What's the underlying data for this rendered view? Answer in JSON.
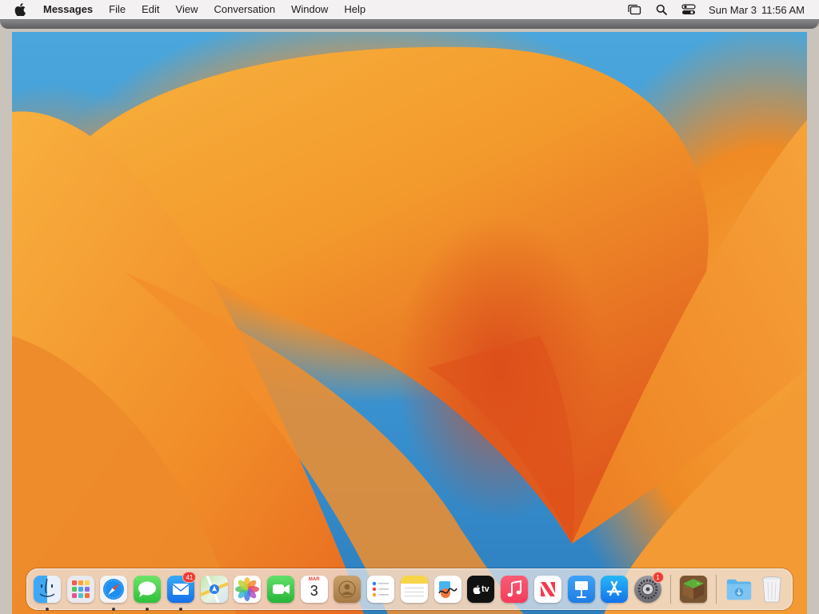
{
  "menubar": {
    "app_name": "Messages",
    "menus": [
      "File",
      "Edit",
      "View",
      "Conversation",
      "Window",
      "Help"
    ],
    "status_icons": [
      "stage-manager-icon",
      "spotlight-search-icon",
      "control-center-icon"
    ],
    "date": "Sun Mar 3",
    "time": "11:56 AM"
  },
  "dock": {
    "apps": [
      {
        "name": "Finder",
        "icon": "finder-icon",
        "running": true
      },
      {
        "name": "Launchpad",
        "icon": "launchpad-icon",
        "running": false
      },
      {
        "name": "Safari",
        "icon": "safari-icon",
        "running": true
      },
      {
        "name": "Messages",
        "icon": "messages-icon",
        "running": true
      },
      {
        "name": "Mail",
        "icon": "mail-icon",
        "running": true,
        "badge": "41"
      },
      {
        "name": "Maps",
        "icon": "maps-icon",
        "running": false
      },
      {
        "name": "Photos",
        "icon": "photos-icon",
        "running": false
      },
      {
        "name": "FaceTime",
        "icon": "facetime-icon",
        "running": false
      },
      {
        "name": "Calendar",
        "icon": "calendar-icon",
        "running": false,
        "month": "MAR",
        "day": "3"
      },
      {
        "name": "Contacts",
        "icon": "contacts-icon",
        "running": false
      },
      {
        "name": "Reminders",
        "icon": "reminders-icon",
        "running": false
      },
      {
        "name": "Notes",
        "icon": "notes-icon",
        "running": false
      },
      {
        "name": "Freeform",
        "icon": "freeform-icon",
        "running": false
      },
      {
        "name": "TV",
        "icon": "apple-tv-icon",
        "running": false,
        "label": "tv"
      },
      {
        "name": "Music",
        "icon": "music-icon",
        "running": false
      },
      {
        "name": "News",
        "icon": "news-icon",
        "running": false
      },
      {
        "name": "Keynote",
        "icon": "keynote-icon",
        "running": false
      },
      {
        "name": "App Store",
        "icon": "app-store-icon",
        "running": false
      },
      {
        "name": "System Settings",
        "icon": "system-settings-icon",
        "running": false,
        "badge": "1"
      },
      {
        "name": "Minecraft",
        "icon": "minecraft-icon",
        "running": false
      }
    ],
    "stacks": [
      {
        "name": "Downloads",
        "icon": "downloads-folder-icon"
      },
      {
        "name": "Trash",
        "icon": "trash-icon"
      }
    ]
  },
  "colors": {
    "menubar_bg": "#f3f1f1",
    "wallpaper_orange": "#f2902a",
    "wallpaper_blue": "#3b93d0",
    "badge_red": "#ef3b30"
  }
}
